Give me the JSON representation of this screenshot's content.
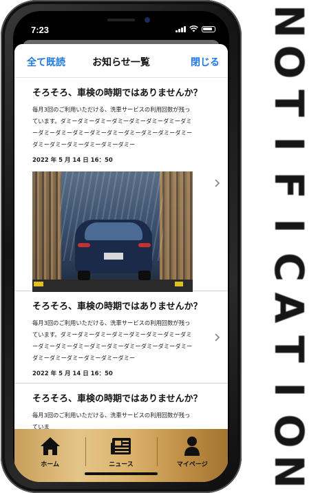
{
  "status_bar": {
    "time": "7:23"
  },
  "nav": {
    "mark_all_read": "全て既読",
    "title": "お知らせ一覧",
    "close": "閉じる"
  },
  "items": [
    {
      "title": "そろそろ、車検の時期ではありませんか？",
      "body": "毎月3回のご利用いただける、洗車サービスの利用回数が残っています。ダミーダミーダミーダミーダミーダミーダミーダミーダミーダミーダミーダミーダミーダミーダミーダミーダミーダミーダミーダミーダミーダミーダミー",
      "date": "2022 年 5 月 14 日 16：50",
      "has_image": true
    },
    {
      "title": "そろそろ、車検の時期ではありませんか？",
      "body": "毎月3回のご利用いただける、洗車サービスの利用回数が残っています。ダミーダミーダミーダミーダミーダミーダミーダミーダミーダミーダミーダミーダミーダミーダミーダミーダミーダミーダミーダミーダミーダミーダミー",
      "date": "2022 年 5 月 14 日 16：50",
      "has_image": false
    },
    {
      "title": "そろそろ、車検の時期ではありませんか？",
      "body": "毎月3回のご利用いただける、洗車サービスの利用回数が残っていま",
      "date": "",
      "has_image": false
    }
  ],
  "tabs": [
    {
      "label": "ホーム",
      "icon": "home-icon"
    },
    {
      "label": "ニュース",
      "icon": "newspaper-icon"
    },
    {
      "label": "マイページ",
      "icon": "user-icon"
    }
  ],
  "side_word": "NOTIFICATION",
  "side_letters": [
    "N",
    "O",
    "T",
    "I",
    "F",
    "I",
    "C",
    "A",
    "T",
    "I",
    "O",
    "N"
  ],
  "colors": {
    "accent": "#1f7ae0",
    "tabbar_gold": "#dbb26a",
    "side_text": "#161616"
  }
}
